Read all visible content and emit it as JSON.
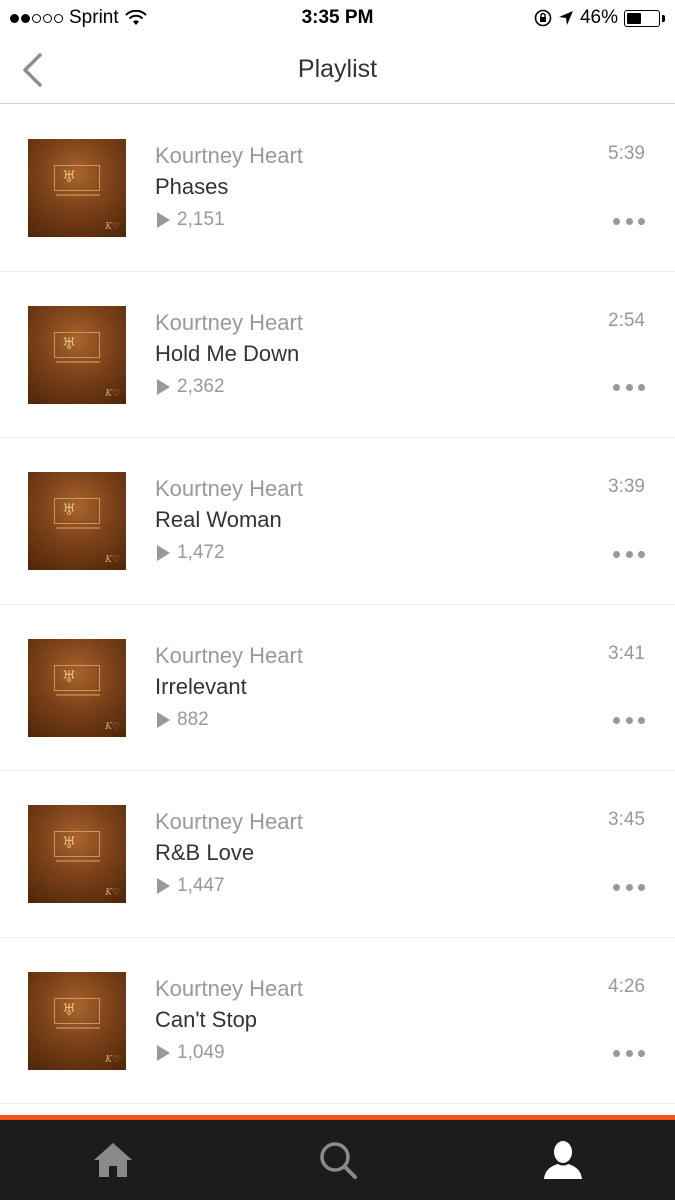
{
  "status_bar": {
    "carrier": "Sprint",
    "time": "3:35 PM",
    "battery_percent": "46%",
    "battery_level": 0.46,
    "signal_bars_filled": 2,
    "signal_bars_total": 5
  },
  "nav": {
    "title": "Playlist"
  },
  "tracks": [
    {
      "artist": "Kourtney Heart",
      "title": "Phases",
      "plays": "2,151",
      "duration": "5:39"
    },
    {
      "artist": "Kourtney Heart",
      "title": "Hold Me Down",
      "plays": "2,362",
      "duration": "2:54"
    },
    {
      "artist": "Kourtney Heart",
      "title": "Real Woman",
      "plays": "1,472",
      "duration": "3:39"
    },
    {
      "artist": "Kourtney Heart",
      "title": "Irrelevant",
      "plays": "882",
      "duration": "3:41"
    },
    {
      "artist": "Kourtney Heart",
      "title": "R&B Love",
      "plays": "1,447",
      "duration": "3:45"
    },
    {
      "artist": "Kourtney Heart",
      "title": "Can't Stop",
      "plays": "1,049",
      "duration": "4:26"
    }
  ],
  "tab_bar": {
    "tabs": [
      {
        "icon": "home-icon",
        "active": false
      },
      {
        "icon": "search-icon",
        "active": false
      },
      {
        "icon": "profile-icon",
        "active": true
      }
    ]
  },
  "colors": {
    "accent": "#f2541b",
    "tab_bar_bg": "#1c1c1c",
    "tab_inactive": "#8a8a8a",
    "tab_active": "#ffffff",
    "secondary_text": "#999999",
    "primary_text": "#333333"
  }
}
